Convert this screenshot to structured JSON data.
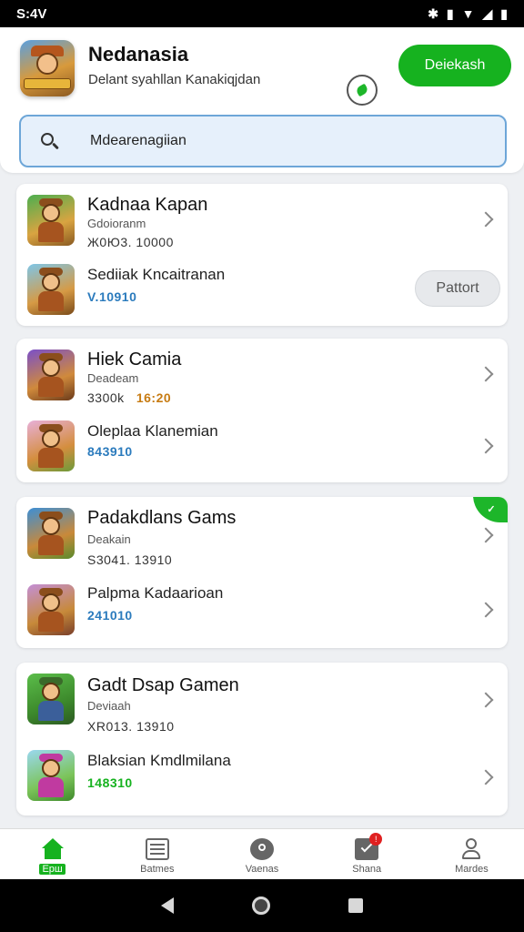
{
  "status_bar": {
    "time": "S:4V",
    "icons": [
      "bluetooth-icon",
      "signal-icon",
      "wifi-icon",
      "battery-icon"
    ]
  },
  "header": {
    "title": "Nedanasia",
    "subtitle": "Delant syahllan Kanakiqjdan",
    "primary_button": "Deiekash"
  },
  "search": {
    "value": "Mdearenagiian"
  },
  "cards": [
    {
      "rows": [
        {
          "title": "Kadnaa Kapan",
          "sub": "Gdoioranm",
          "meta": "Ж0Ю3.   10000"
        },
        {
          "name": "Sediiak Kncaitranan",
          "version": "V.10910",
          "button": "Pattort"
        }
      ]
    },
    {
      "rows": [
        {
          "title": "Hiek Camia",
          "sub": "Deadeam",
          "meta_a": "3300k",
          "meta_b": "16:20"
        },
        {
          "name": "Oleplaa Klanemian",
          "version": "843910"
        }
      ]
    },
    {
      "badge": "✓",
      "rows": [
        {
          "title": "Padakdlans Gams",
          "sub": "Deakain",
          "meta": "S3041.   13910"
        },
        {
          "name": "Palpma Kadaarioan",
          "version": "241010"
        }
      ]
    },
    {
      "rows": [
        {
          "title": "Gadt Dsap Gamen",
          "sub": "Deviaah",
          "meta": "XR013.   13910"
        },
        {
          "name": "Blaksiаn Kmdlmilana",
          "version": "148310"
        }
      ]
    }
  ],
  "bottom_nav": [
    {
      "label": "Ерш",
      "icon": "home-icon"
    },
    {
      "label": "Batmes",
      "icon": "list-icon"
    },
    {
      "label": "Vaenas",
      "icon": "disc-icon"
    },
    {
      "label": "Shana",
      "icon": "share-icon",
      "badge": "!"
    },
    {
      "label": "Mardes",
      "icon": "profile-icon"
    }
  ],
  "colors": {
    "accent": "#16b21f",
    "link_blue": "#2b7bbd",
    "amber": "#c77b12"
  }
}
